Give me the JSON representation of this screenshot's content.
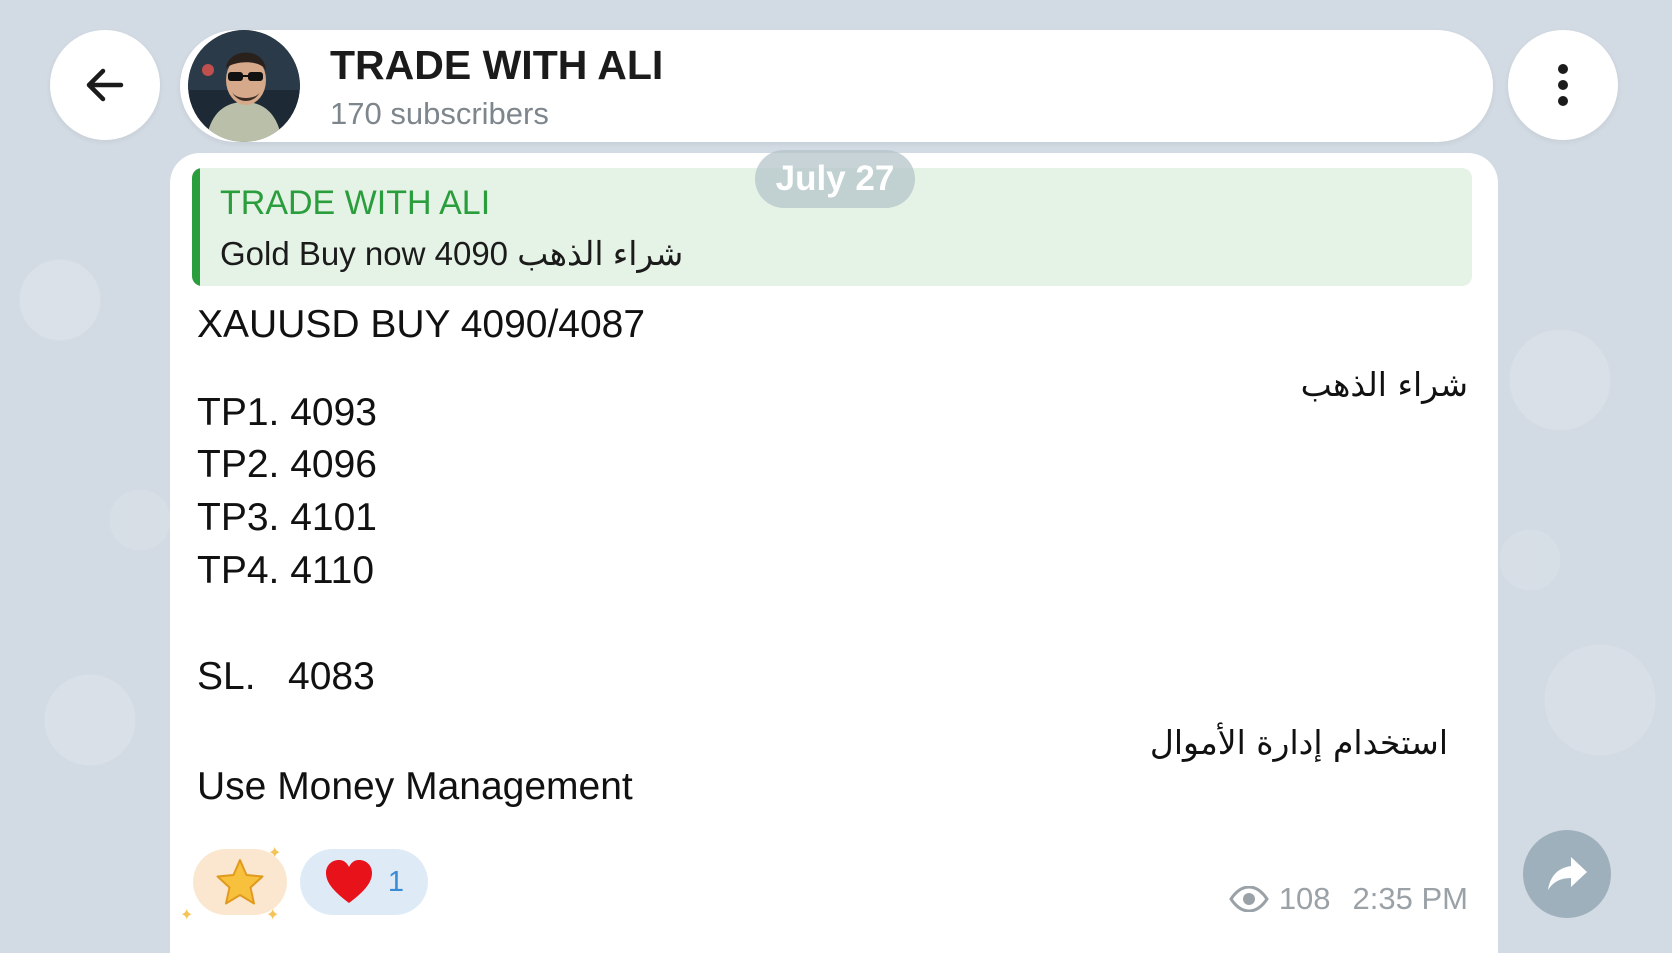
{
  "header": {
    "channel_title": "TRADE WITH ALI",
    "subscribers": "170 subscribers",
    "back_icon": "arrow-left-icon",
    "menu_icon": "more-vertical-icon",
    "avatar": "channel-avatar"
  },
  "date_separator": "July 27",
  "message": {
    "reply": {
      "author": "TRADE WITH ALI",
      "text": "Gold Buy now 4090 شراء الذهب"
    },
    "lines": {
      "signal": "XAUUSD BUY 4090/4087",
      "arabic_buy": "شراء الذهب",
      "tp1": "TP1. 4093",
      "tp2": "TP2. 4096",
      "tp3": "TP3. 4101",
      "tp4": "TP4. 4110",
      "sl": "SL.   4083",
      "arabic_money_management": "استخدام إدارة الأموال",
      "money_management": "Use Money Management"
    },
    "reactions": [
      {
        "icon": "star-icon",
        "count": ""
      },
      {
        "icon": "heart-icon",
        "count": "1"
      }
    ],
    "views": "108",
    "time": "2:35 PM",
    "views_icon": "eye-icon"
  },
  "share_icon": "share-arrow-icon",
  "colors": {
    "background": "#d2dae3",
    "reply_accent": "#2a9d3c",
    "reply_background": "#e5f3e6",
    "meta_text": "#9aa2a8",
    "reaction_count": "#3a8bd6"
  }
}
